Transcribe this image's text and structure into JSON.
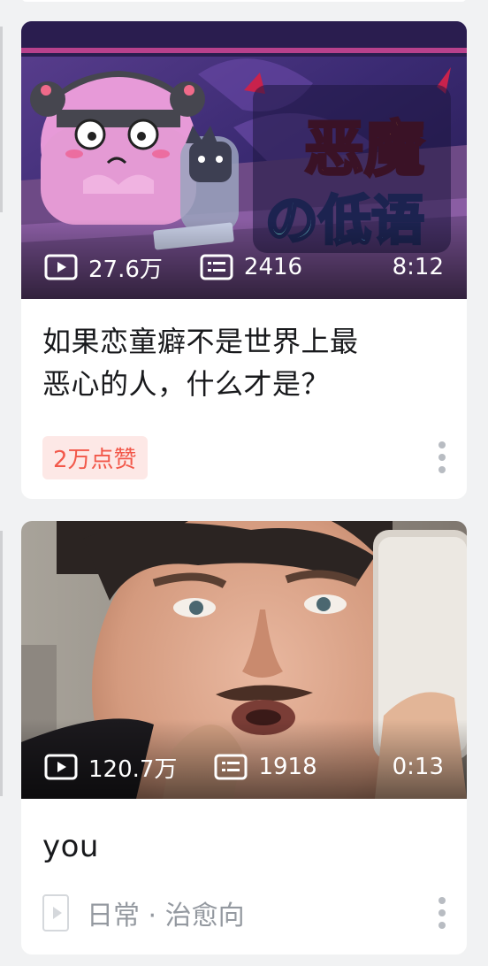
{
  "feed": {
    "cards": [
      {
        "thumbnail_text": [
          "恶魔",
          "の低语"
        ],
        "views": "27.6万",
        "comments": "2416",
        "duration": "8:12",
        "title_lines": [
          "如果恋童癖不是世界上最",
          "恶心的人，什么才是？"
        ],
        "badge": "2万点赞"
      },
      {
        "views": "120.7万",
        "comments": "1918",
        "duration": "0:13",
        "title": "you",
        "tag": "日常 · 治愈向"
      }
    ]
  },
  "icons": {
    "play": "play-count-icon",
    "danmaku": "danmaku-count-icon",
    "more": "more-vertical-icon",
    "tag": "video-tag-icon"
  },
  "colors": {
    "badge_bg": "#fde8e6",
    "badge_text": "#f2584a",
    "title": "#18191c",
    "muted": "#9499a0"
  }
}
